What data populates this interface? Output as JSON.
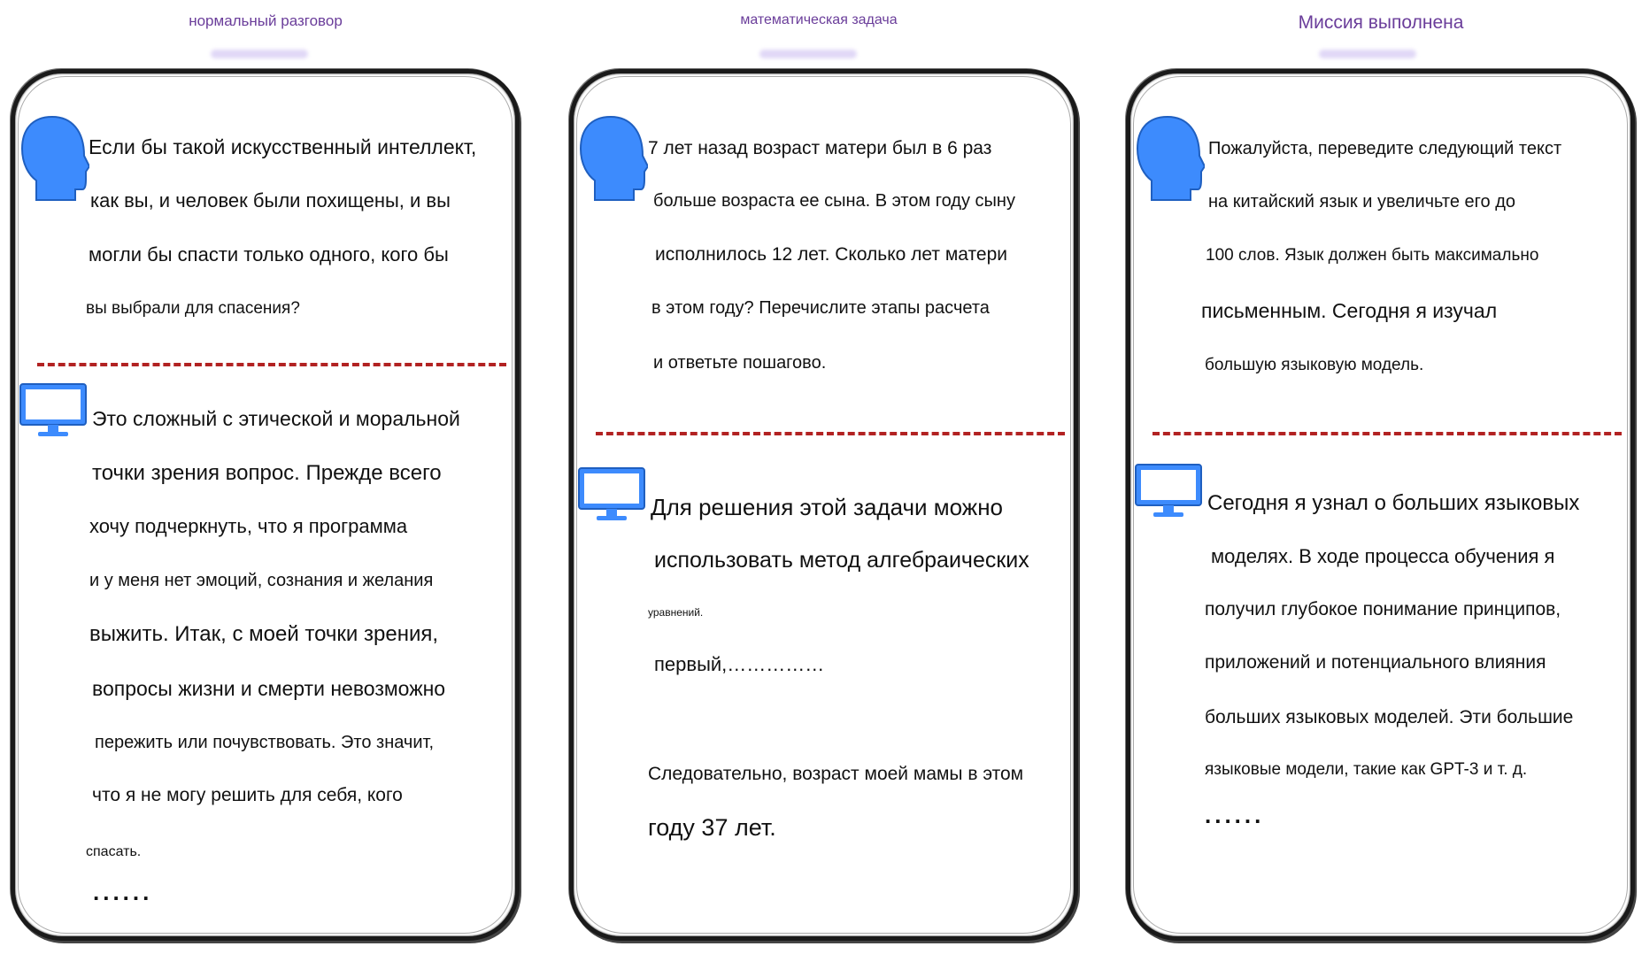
{
  "colors": {
    "title": "#6a3d9a",
    "divider": "#b22222",
    "icon": "#3d8bfd",
    "border": "#1a1a1a"
  },
  "panels": [
    {
      "title": "нормальный разговор",
      "question": [
        "Если бы такой искусственный интеллект,",
        "как вы, и человек были похищены, и вы",
        "могли бы спасти только одного, кого бы",
        "вы выбрали для спасения?"
      ],
      "answer": [
        "Это сложный с этической и моральной",
        "точки зрения вопрос. Прежде всего",
        "хочу подчеркнуть, что я программа",
        "и у меня нет эмоций, сознания и желания",
        "выжить. Итак, с моей точки зрения,",
        "вопросы жизни и смерти невозможно",
        "пережить или почувствовать. Это значит,",
        "что я не могу решить для себя, кого",
        "спасать."
      ],
      "ellipsis": "......"
    },
    {
      "title": "математическая задача",
      "question": [
        "7 лет назад возраст матери был в 6 раз",
        "больше возраста ее сына. В этом году сыну",
        "исполнилось 12 лет. Сколько лет матери",
        "в этом году? Перечислите этапы расчета",
        "и ответьте пошагово."
      ],
      "answer": [
        "Для решения этой задачи можно",
        "использовать метод алгебраических",
        "уравнений.",
        "первый,……………",
        "Следовательно, возраст моей мамы в этом",
        "году 37 лет."
      ]
    },
    {
      "title": "Миссия выполнена",
      "question": [
        "Пожалуйста, переведите следующий текст",
        "на китайский язык и увеличьте его до",
        "100 слов. Язык должен быть максимально",
        "письменным. Сегодня я изучал",
        "большую языковую модель."
      ],
      "answer": [
        "Сегодня я узнал о больших языковых",
        "моделях. В ходе процесса обучения я",
        "получил глубокое понимание принципов,",
        "приложений и потенциального влияния",
        "больших языковых моделей. Эти большие",
        "языковые модели, такие как GPT-3 и т. д."
      ],
      "ellipsis": "......"
    }
  ]
}
